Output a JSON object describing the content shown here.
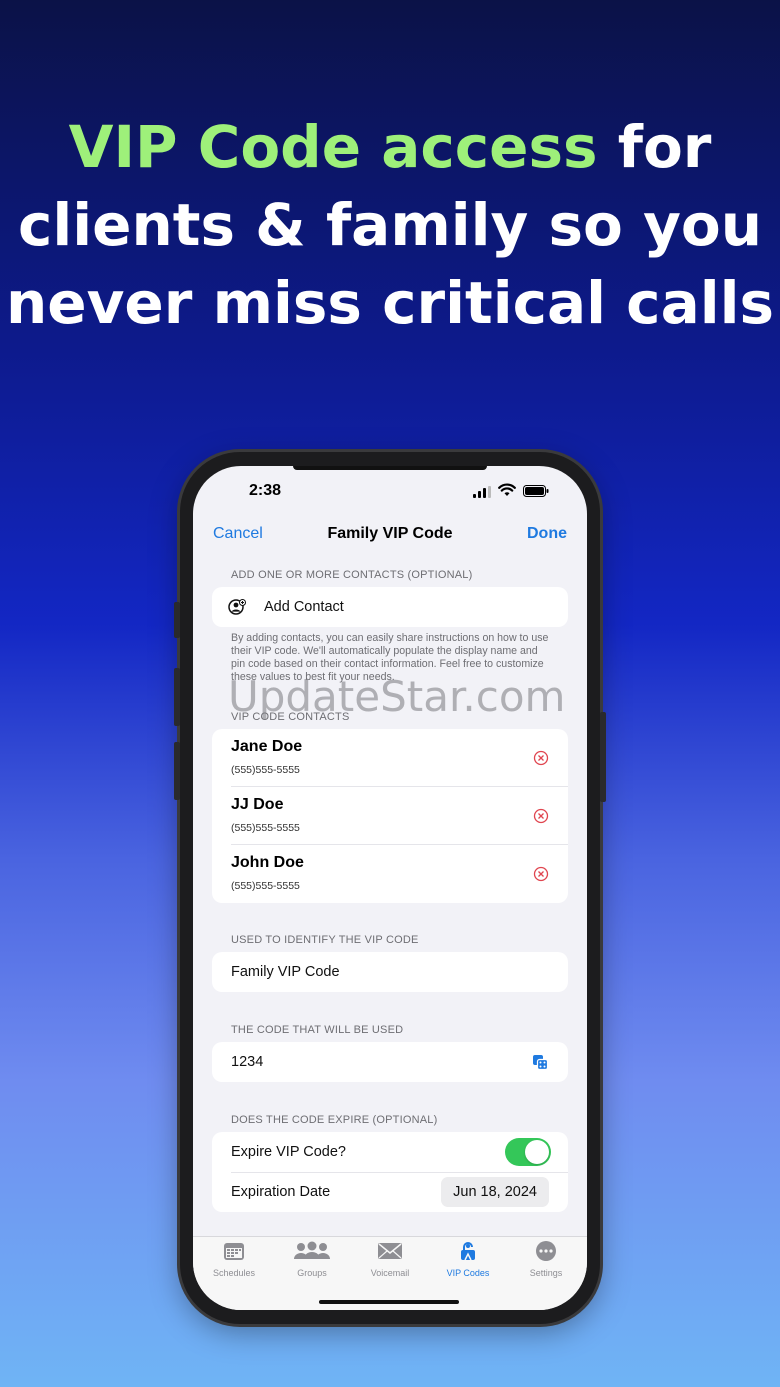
{
  "headline": {
    "accent": "VIP Code access",
    "line1_rest": " for",
    "line2": "clients & family so you",
    "line3": "never miss critical calls"
  },
  "status_bar": {
    "time": "2:38"
  },
  "nav": {
    "cancel": "Cancel",
    "title": "Family VIP Code",
    "done": "Done"
  },
  "add_section": {
    "header": "ADD ONE OR MORE CONTACTS (OPTIONAL)",
    "add_label": "Add Contact",
    "footnote": "By adding contacts, you can easily share instructions on how to use their VIP code. We'll automatically populate the display name and pin code based on their contact information. Feel free to customize these values to best fit your needs."
  },
  "contacts_section": {
    "header": "VIP CODE CONTACTS",
    "contacts": [
      {
        "name": "Jane Doe",
        "phone": "(555)555-5555"
      },
      {
        "name": "JJ Doe",
        "phone": "(555)555-5555"
      },
      {
        "name": "John Doe",
        "phone": "(555)555-5555"
      }
    ]
  },
  "name_section": {
    "header": "USED TO IDENTIFY THE VIP CODE",
    "value": "Family VIP Code"
  },
  "code_section": {
    "header": "THE CODE THAT WILL BE USED",
    "value": "1234"
  },
  "expire_section": {
    "header": "DOES THE CODE EXPIRE (OPTIONAL)",
    "toggle_label": "Expire VIP Code?",
    "toggle_on": true,
    "date_label": "Expiration Date",
    "date_value": "Jun 18, 2024"
  },
  "tabs": [
    {
      "label": "Schedules",
      "icon": "calendar-icon",
      "active": false
    },
    {
      "label": "Groups",
      "icon": "people-icon",
      "active": false
    },
    {
      "label": "Voicemail",
      "icon": "envelope-icon",
      "active": false
    },
    {
      "label": "VIP Codes",
      "icon": "vip-lock-icon",
      "active": true
    },
    {
      "label": "Settings",
      "icon": "ellipsis-icon",
      "active": false
    }
  ],
  "watermark": "UpdateStar.com",
  "colors": {
    "accent": "#9ef07a",
    "link": "#1f7ae0",
    "toggle": "#34c759",
    "remove": "#e0454f"
  }
}
